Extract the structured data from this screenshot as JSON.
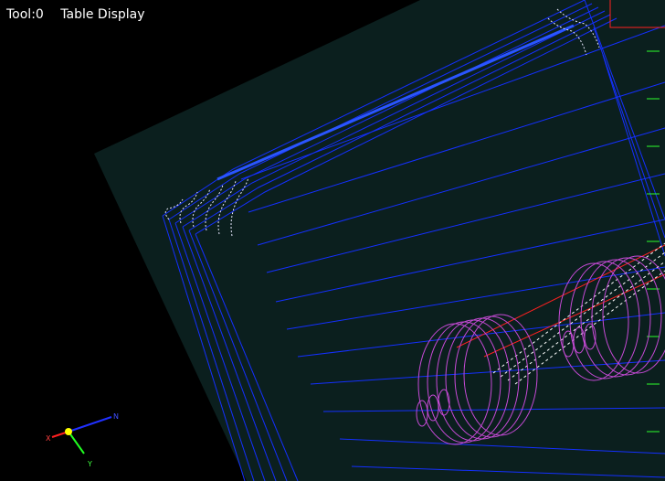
{
  "hud": {
    "tool_label": "Tool:0",
    "mode_label": "Table Display"
  },
  "colors": {
    "background": "#000000",
    "table_plane": "#0b1f1e",
    "toolpath": "#1430ff",
    "toolpath_bright": "#2a55ff",
    "helix": "#c64ad6",
    "boundary": "#ff2020",
    "tick": "#2cff2c",
    "rapid": "#ffffff"
  },
  "axes": {
    "x_label": "X",
    "y_label": "Y",
    "z_label": "N"
  }
}
